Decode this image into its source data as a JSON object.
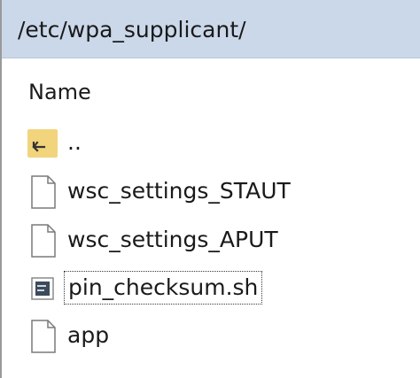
{
  "window": {
    "path": "/etc/wpa_supplicant/"
  },
  "columns": {
    "name": "Name"
  },
  "entries": [
    {
      "name": "..",
      "icon": "parent-folder-icon",
      "type": "parent"
    },
    {
      "name": "wsc_settings_STAUT",
      "icon": "file-icon",
      "type": "file"
    },
    {
      "name": "wsc_settings_APUT",
      "icon": "file-icon",
      "type": "file"
    },
    {
      "name": "pin_checksum.sh",
      "icon": "script-file-icon",
      "type": "file",
      "focused": true
    },
    {
      "name": "app",
      "icon": "file-icon",
      "type": "file"
    }
  ],
  "colors": {
    "path_bar": "#cbd8ea",
    "folder": "#f2d47c"
  }
}
